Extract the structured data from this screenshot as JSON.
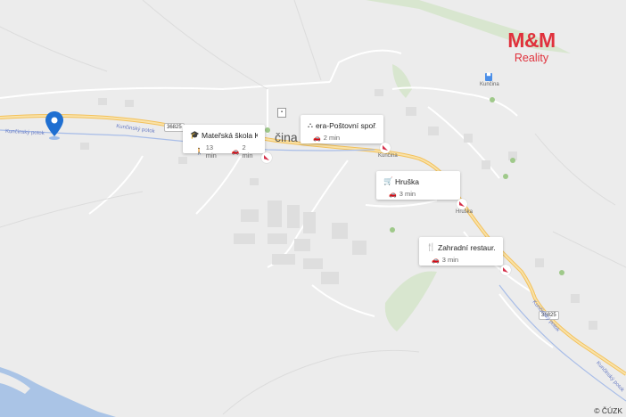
{
  "brand": {
    "name": "M&M",
    "sub": "Reality",
    "color": "#e0313c"
  },
  "map": {
    "town_label": "čina",
    "small_labels": {
      "station_top": "Kunčina",
      "station_mid": "Kunčina",
      "hruska_small": "Hruška"
    },
    "road_shields": [
      "36825",
      "36825"
    ],
    "stream_labels": [
      "Kunčinský potok",
      "Kunčinský potok",
      "Kunčinský potok",
      "Kunčinský potok"
    ],
    "copyright": "© ČÚZK",
    "pin_icon": "location-pin-icon",
    "pin_color": "#1f6fd1"
  },
  "pois": [
    {
      "title": "Mateřská škola K...",
      "icon": "graduation-cap-icon",
      "walk": "13 min",
      "car": "2 min"
    },
    {
      "title": "era-Poštovní spoř...",
      "icon": "bank-network-icon",
      "car": "2 min"
    },
    {
      "title": "Hruška",
      "icon": "shopping-cart-icon",
      "car": "3 min"
    },
    {
      "title": "Zahradní restaur...",
      "icon": "cutlery-icon",
      "car": "3 min"
    }
  ]
}
